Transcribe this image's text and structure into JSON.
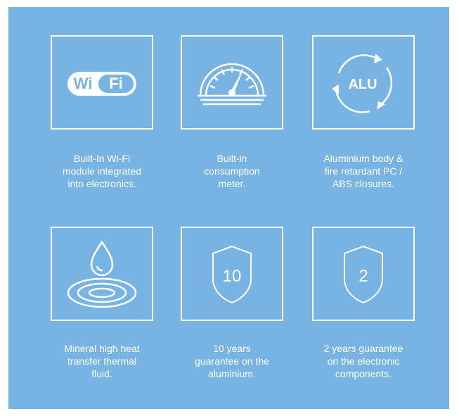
{
  "features": [
    {
      "icon": "wifi-icon",
      "icon_text_1": "Wi",
      "icon_text_2": "Fi",
      "caption": "Built-In Wi-Fi\nmodule integrated\ninto electronics."
    },
    {
      "icon": "gauge-meter-icon",
      "caption": "Built-in\nconsumption\nmeter."
    },
    {
      "icon": "aluminium-recycle-icon",
      "icon_text": "ALU",
      "caption": "Aluminium body &\nfire retardant PC /\nABS closures."
    },
    {
      "icon": "thermal-fluid-drop-icon",
      "caption": "Mineral high heat\ntransfer thermal\nfluid."
    },
    {
      "icon": "shield-10-icon",
      "icon_text": "10",
      "caption": "10 years\nguarantee on the\naluminium."
    },
    {
      "icon": "shield-2-icon",
      "icon_text": "2",
      "caption": "2 years guarantee\non the electronic\ncomponents."
    }
  ],
  "colors": {
    "background": "#78b4e3",
    "foreground": "#ffffff"
  }
}
